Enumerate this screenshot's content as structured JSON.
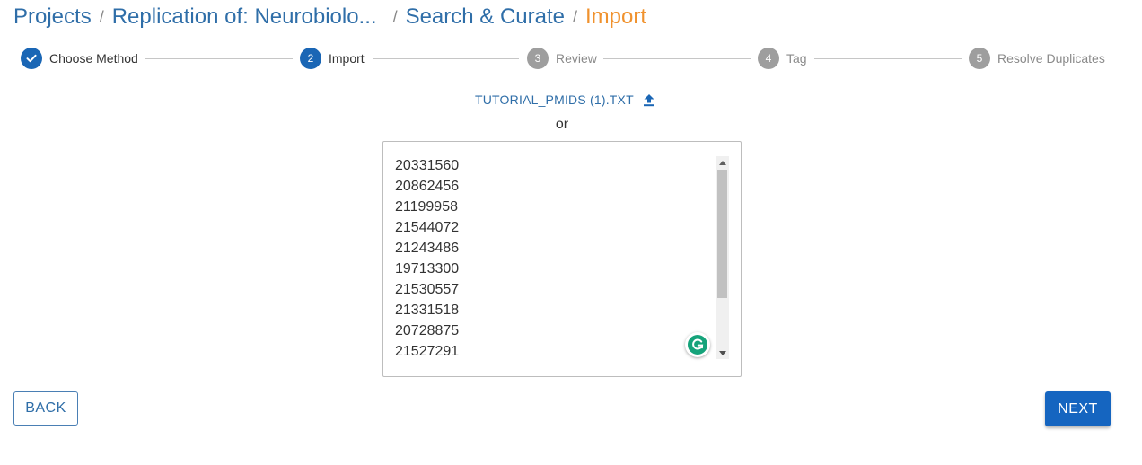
{
  "breadcrumb": {
    "projects": "Projects",
    "separator": "/",
    "project": "Replication of: Neurobiolo...",
    "section": "Search & Curate",
    "current": "Import"
  },
  "stepper": {
    "steps": [
      {
        "number": "1",
        "label": "Choose Method",
        "state": "completed"
      },
      {
        "number": "2",
        "label": "Import",
        "state": "active"
      },
      {
        "number": "3",
        "label": "Review",
        "state": "inactive"
      },
      {
        "number": "4",
        "label": "Tag",
        "state": "inactive"
      },
      {
        "number": "5",
        "label": "Resolve Duplicates",
        "state": "inactive"
      }
    ]
  },
  "upload": {
    "filename": "TUTORIAL_PMIDS (1).TXT",
    "icon": "upload-icon"
  },
  "or_text": "or",
  "pmid_list": [
    "20331560",
    "20862456",
    "21199958",
    "21544072",
    "21243486",
    "19713300",
    "21530557",
    "21331518",
    "20728875",
    "21527291"
  ],
  "buttons": {
    "back": "BACK",
    "next": "NEXT"
  },
  "colors": {
    "primary": "#1565c0",
    "link": "#2f6ea8",
    "current_crumb": "#f0922e",
    "inactive_step": "#9e9e9e",
    "grammarly": "#15a37a"
  }
}
